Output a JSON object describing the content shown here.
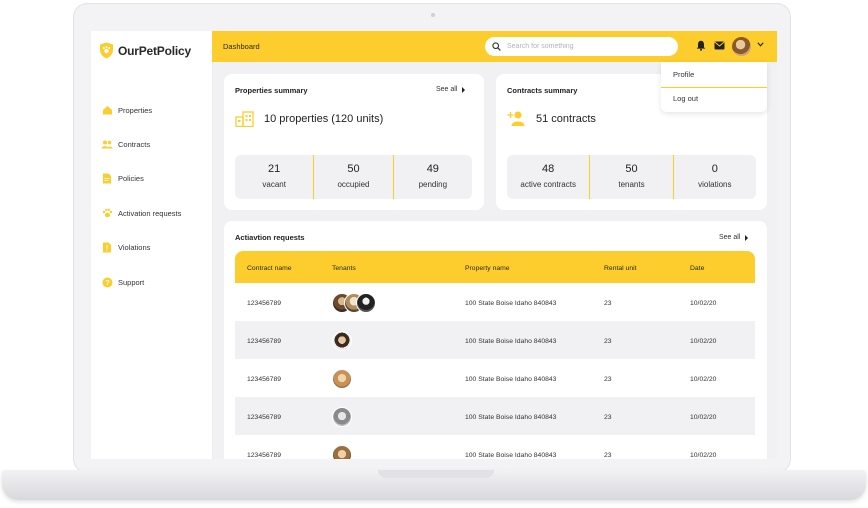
{
  "app": {
    "name": "OurPetPolicy"
  },
  "sidebar": {
    "items": [
      {
        "label": "Properties",
        "icon": "house-icon"
      },
      {
        "label": "Contracts",
        "icon": "people-icon"
      },
      {
        "label": "Policies",
        "icon": "document-icon"
      },
      {
        "label": "Activation requests",
        "icon": "paw-icon"
      },
      {
        "label": "Violations",
        "icon": "file-alert-icon"
      },
      {
        "label": "Support",
        "icon": "help-icon"
      }
    ]
  },
  "header": {
    "breadcrumb": "Dashboard",
    "search_placeholder": "Search for something"
  },
  "user_menu": {
    "items": [
      "Profile",
      "Log out"
    ]
  },
  "properties_summary": {
    "title": "Properties summary",
    "see_all": "See all",
    "headline": "10 properties (120 units)",
    "stats": [
      {
        "value": "21",
        "label": "vacant"
      },
      {
        "value": "50",
        "label": "occupied"
      },
      {
        "value": "49",
        "label": "pending"
      }
    ]
  },
  "contracts_summary": {
    "title": "Contracts summary",
    "headline": "51 contracts",
    "stats": [
      {
        "value": "48",
        "label": "active contracts"
      },
      {
        "value": "50",
        "label": "tenants"
      },
      {
        "value": "0",
        "label": "violations"
      }
    ]
  },
  "activation_requests": {
    "title": "Actiavtion requests",
    "see_all": "See all",
    "columns": [
      "Contract name",
      "Tenants",
      "Property name",
      "Rental unit",
      "Date"
    ],
    "rows": [
      {
        "contract": "123456789",
        "tenants": 3,
        "property": "100 State Boise Idaho 840843",
        "unit": "23",
        "date": "10/02/20"
      },
      {
        "contract": "123456789",
        "tenants": 1,
        "property": "100 State Boise Idaho 840843",
        "unit": "23",
        "date": "10/02/20"
      },
      {
        "contract": "123456789",
        "tenants": 1,
        "property": "100 State Boise Idaho 840843",
        "unit": "23",
        "date": "10/02/20"
      },
      {
        "contract": "123456789",
        "tenants": 1,
        "property": "100 State Boise Idaho 840843",
        "unit": "23",
        "date": "10/02/20"
      },
      {
        "contract": "123456789",
        "tenants": 1,
        "property": "100 State Boise Idaho 840843",
        "unit": "23",
        "date": "10/02/20"
      }
    ]
  },
  "colors": {
    "accent": "#FDCD2D",
    "background": "#F1F1F3",
    "text": "#222222"
  }
}
